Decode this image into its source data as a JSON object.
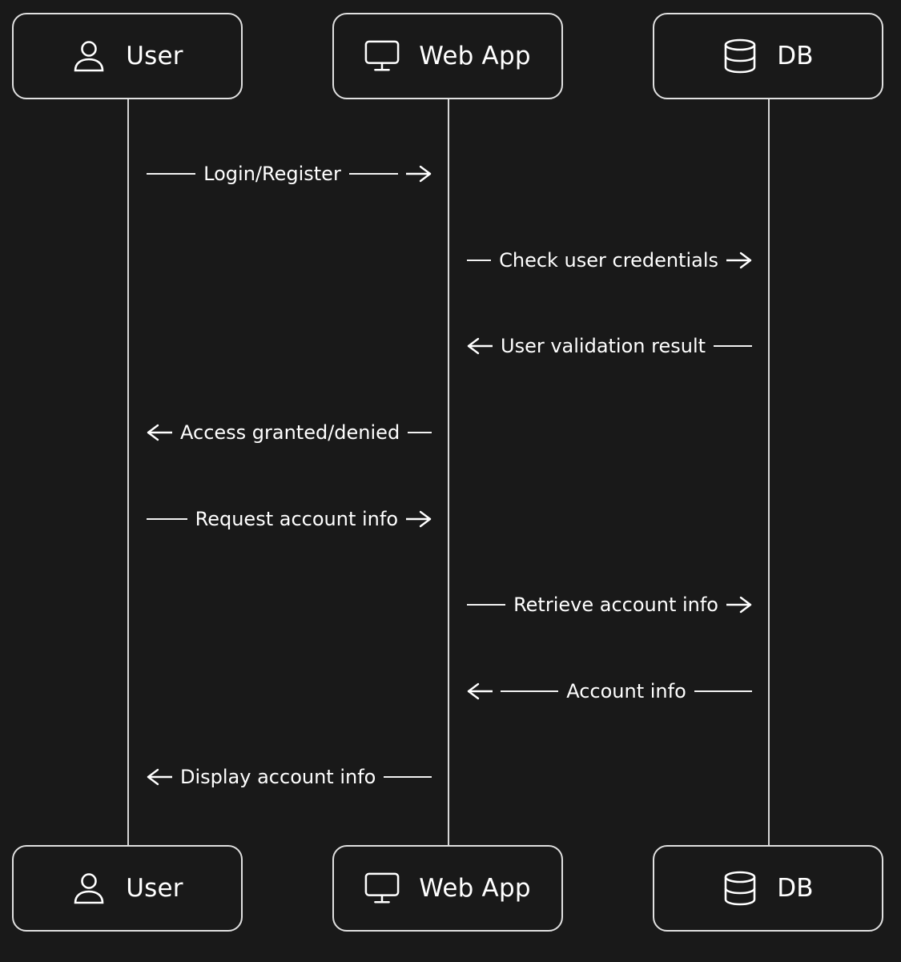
{
  "participants": [
    {
      "id": "user",
      "label": "User",
      "icon": "user-icon"
    },
    {
      "id": "webapp",
      "label": "Web App",
      "icon": "monitor-icon"
    },
    {
      "id": "db",
      "label": "DB",
      "icon": "database-icon"
    }
  ],
  "messages": [
    {
      "from": "User",
      "to": "Web App",
      "text": "Login/Register",
      "direction": "right"
    },
    {
      "from": "Web App",
      "to": "DB",
      "text": "Check user credentials",
      "direction": "right"
    },
    {
      "from": "DB",
      "to": "Web App",
      "text": "User validation result",
      "direction": "left"
    },
    {
      "from": "Web App",
      "to": "User",
      "text": "Access granted/denied",
      "direction": "left"
    },
    {
      "from": "User",
      "to": "Web App",
      "text": "Request account info",
      "direction": "right"
    },
    {
      "from": "Web App",
      "to": "DB",
      "text": "Retrieve account info",
      "direction": "right"
    },
    {
      "from": "DB",
      "to": "Web App",
      "text": "Account info",
      "direction": "left"
    },
    {
      "from": "Web App",
      "to": "User",
      "text": "Display account info",
      "direction": "left"
    }
  ],
  "colors": {
    "background": "#191919",
    "stroke": "#e0e0e0",
    "text": "#ffffff"
  }
}
